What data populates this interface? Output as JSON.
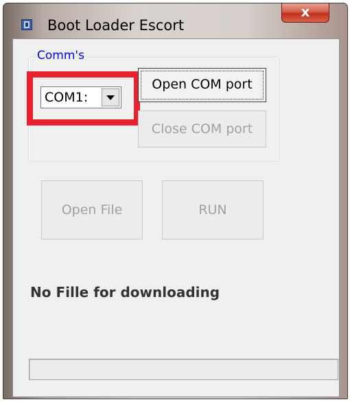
{
  "window": {
    "title": "Boot Loader Escort",
    "close_glyph": "x"
  },
  "comms": {
    "legend": "Comm's",
    "port_value": "COM1:",
    "open_label": "Open COM port",
    "close_label": "Close COM port"
  },
  "actions": {
    "open_file_label": "Open File",
    "run_label": "RUN"
  },
  "status": {
    "message": "No Fille for downloading"
  },
  "progress": {
    "value": 0
  },
  "colors": {
    "highlight": "#e8212d",
    "legend": "#0000ff",
    "close_button": "#c1301c"
  },
  "icons": {
    "app": "app-icon",
    "close": "close-icon",
    "dropdown": "chevron-down-icon"
  }
}
